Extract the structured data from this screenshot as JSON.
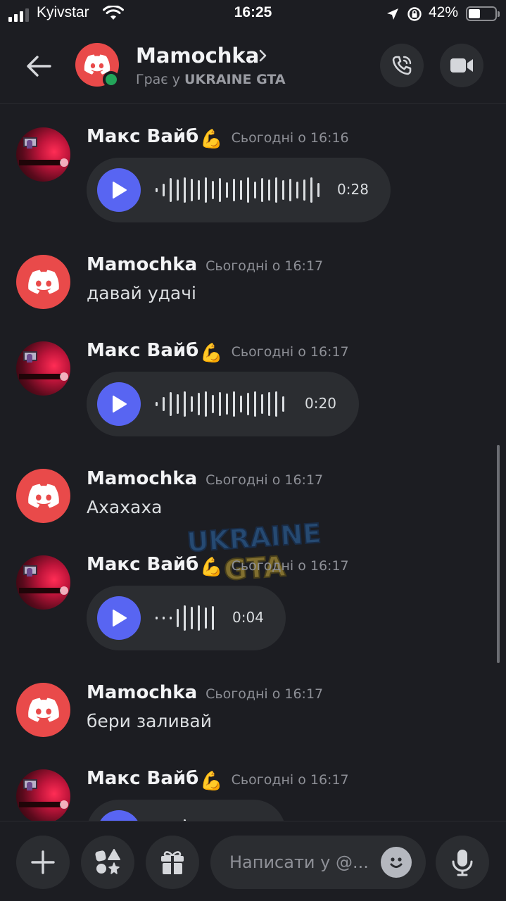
{
  "status_bar": {
    "carrier": "Kyivstar",
    "time": "16:25",
    "battery": "42%",
    "battery_level": 0.42
  },
  "header": {
    "name": "Mamochka",
    "status_prefix": "Грає у ",
    "status_game": "UKRAINE GTA",
    "icons": {
      "back": "arrow-left-icon",
      "call": "phone-icon",
      "video": "video-camera-icon"
    }
  },
  "messages": [
    {
      "type": "voice",
      "author": "Макс Вайб",
      "emoji": "💪",
      "timestamp": "Сьогодні о 16:16",
      "duration": "0:28"
    },
    {
      "type": "text",
      "author": "Mamochka",
      "timestamp": "Сьогодні о 16:17",
      "text": "давай удачі"
    },
    {
      "type": "voice",
      "author": "Макс Вайб",
      "emoji": "💪",
      "timestamp": "Сьогодні о 16:17",
      "duration": "0:20"
    },
    {
      "type": "text",
      "author": "Mamochka",
      "timestamp": "Сьогодні о 16:17",
      "text": "Ахахаха"
    },
    {
      "type": "voice",
      "author": "Макс Вайб",
      "emoji": "💪",
      "timestamp": "Сьогодні о 16:17",
      "duration": "0:04"
    },
    {
      "type": "text",
      "author": "Mamochka",
      "timestamp": "Сьогодні о 16:17",
      "text": "бери заливай"
    },
    {
      "type": "voice",
      "author": "Макс Вайб",
      "emoji": "💪",
      "timestamp": "Сьогодні о 16:17",
      "duration": ""
    }
  ],
  "watermark": {
    "line1": "UKRAINE",
    "line2": "GTA"
  },
  "input_bar": {
    "placeholder": "Написати у @...",
    "icons": {
      "plus": "plus-icon",
      "apps": "apps-icon",
      "gift": "gift-icon",
      "emoji": "emoji-icon",
      "mic": "microphone-icon"
    }
  },
  "colors": {
    "accent": "#5865f2",
    "discord_red": "#e94a4a",
    "online": "#23a55a",
    "background": "#1c1d22",
    "bubble": "#2b2d31"
  }
}
